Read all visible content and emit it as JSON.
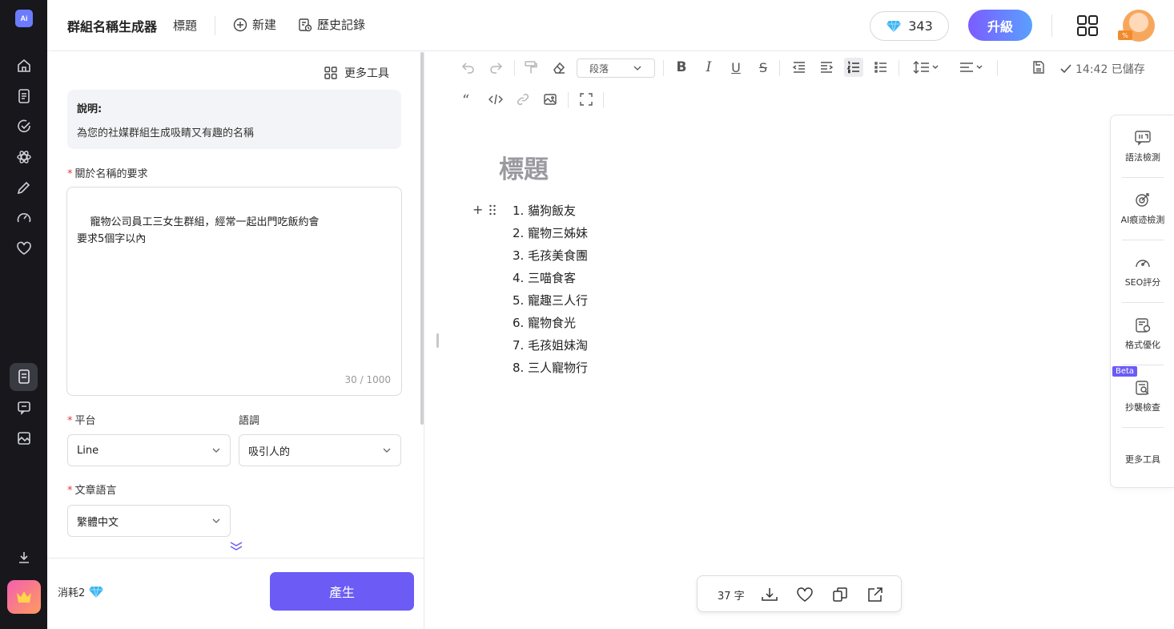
{
  "sidebar": {
    "logo_text": "Ai",
    "icons": [
      "home-icon",
      "document-icon",
      "check-icon",
      "atom-icon",
      "pencil-icon",
      "gauge-icon",
      "heart-icon",
      "writer-icon",
      "chat-icon",
      "image-icon",
      "download-icon",
      "crown-icon"
    ]
  },
  "header": {
    "app_title": "群組名稱生成器",
    "title_tab": "標題",
    "new_label": "新建",
    "history_label": "歷史記錄",
    "gems": "343",
    "upgrade_label": "升級",
    "avatar_badge": "%"
  },
  "panel": {
    "more_tools": "更多工具",
    "description_title": "說明:",
    "description_text": "為您的社媒群組生成吸睛又有趣的名稱",
    "requirement_label": "關於名稱的要求",
    "requirement_value": "寵物公司員工三女生群組，經常一起出門吃飯約會\n要求5個字以內",
    "counter": "30 / 1000",
    "platform_label": "平台",
    "platform_value": "Line",
    "tone_label": "語調",
    "tone_value": "吸引人的",
    "language_label": "文章語言",
    "language_value": "繁體中文",
    "cost_label": "消耗2",
    "generate_label": "產生"
  },
  "editor": {
    "paragraph_select": "段落",
    "saved_status": "14:42 已儲存",
    "doc_title": "標題",
    "items": [
      {
        "num": "1.",
        "text": "貓狗飯友"
      },
      {
        "num": "2.",
        "text": "寵物三姊妹"
      },
      {
        "num": "3.",
        "text": "毛孩美食團"
      },
      {
        "num": "4.",
        "text": "三喵食客"
      },
      {
        "num": "5.",
        "text": "寵趣三人行"
      },
      {
        "num": "6.",
        "text": "寵物食光"
      },
      {
        "num": "7.",
        "text": "毛孩姐妹淘"
      },
      {
        "num": "8.",
        "text": "三人寵物行"
      }
    ],
    "word_count": "37 字"
  },
  "rail": {
    "grammar": "語法檢測",
    "ai_detect": "AI痕迹檢測",
    "seo": "SEO評分",
    "format": "格式優化",
    "beta": "Beta",
    "plagiarism": "抄襲檢查",
    "more": "更多工具"
  },
  "colors": {
    "accent": "#6c5cf5",
    "sidebar": "#17171c",
    "required": "#e23b3b"
  }
}
